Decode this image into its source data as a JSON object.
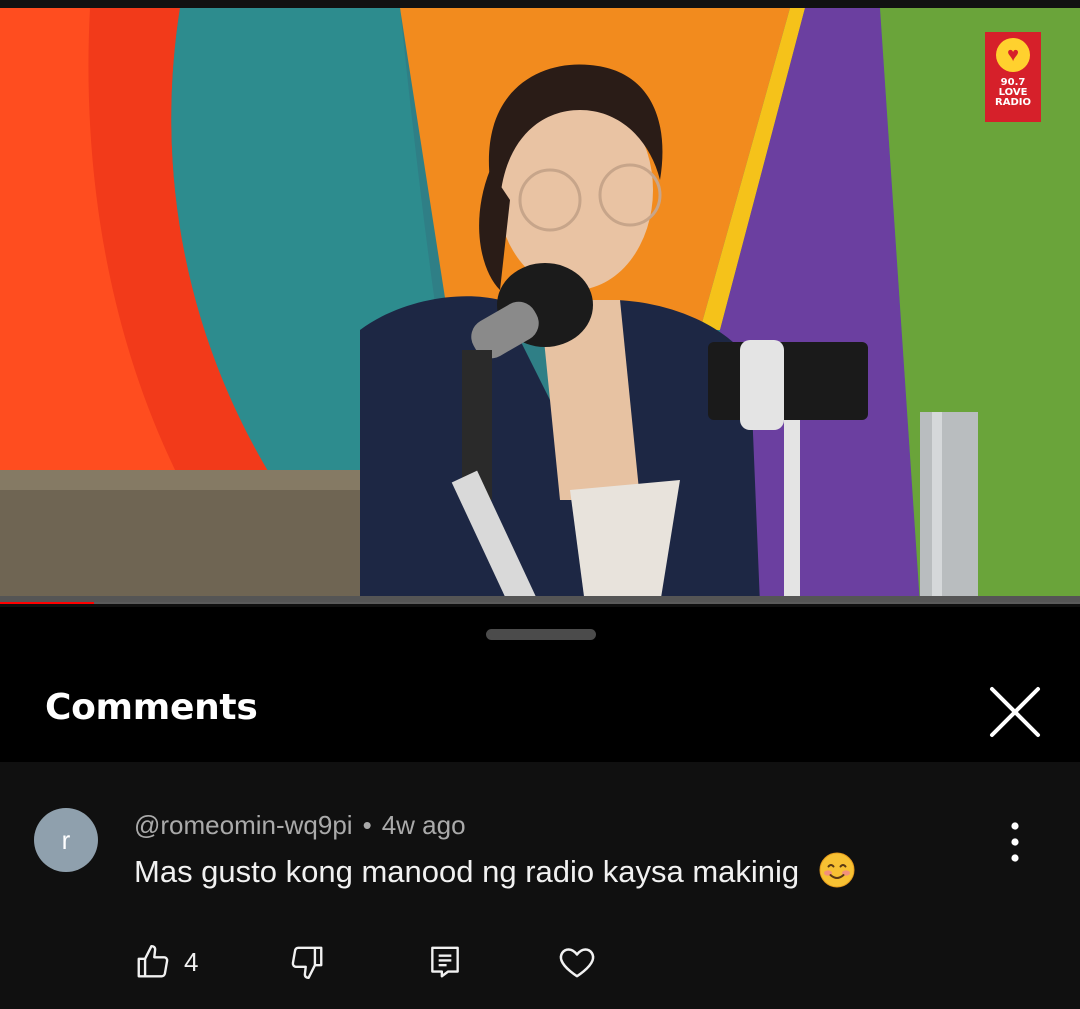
{
  "video": {
    "logo": {
      "text": "90.7 LOVE RADIO",
      "icon": "heart-icon",
      "color": "#d6202a"
    },
    "progress": 0.087
  },
  "comments_panel": {
    "title": "Comments",
    "close_icon": "close-icon"
  },
  "comments": [
    {
      "avatar_letter": "r",
      "avatar_color": "#8fa0ad",
      "author": "@romeomin-wq9pi",
      "separator": "•",
      "time": "4w ago",
      "text": "Mas gusto kong manood ng radio kaysa makinig",
      "emoji": "smiling-face-icon",
      "like_count": "4",
      "actions": [
        "thumbs-up-icon",
        "thumbs-down-icon",
        "reply-icon",
        "heart-icon"
      ],
      "menu_icon": "more-vertical-icon"
    }
  ]
}
